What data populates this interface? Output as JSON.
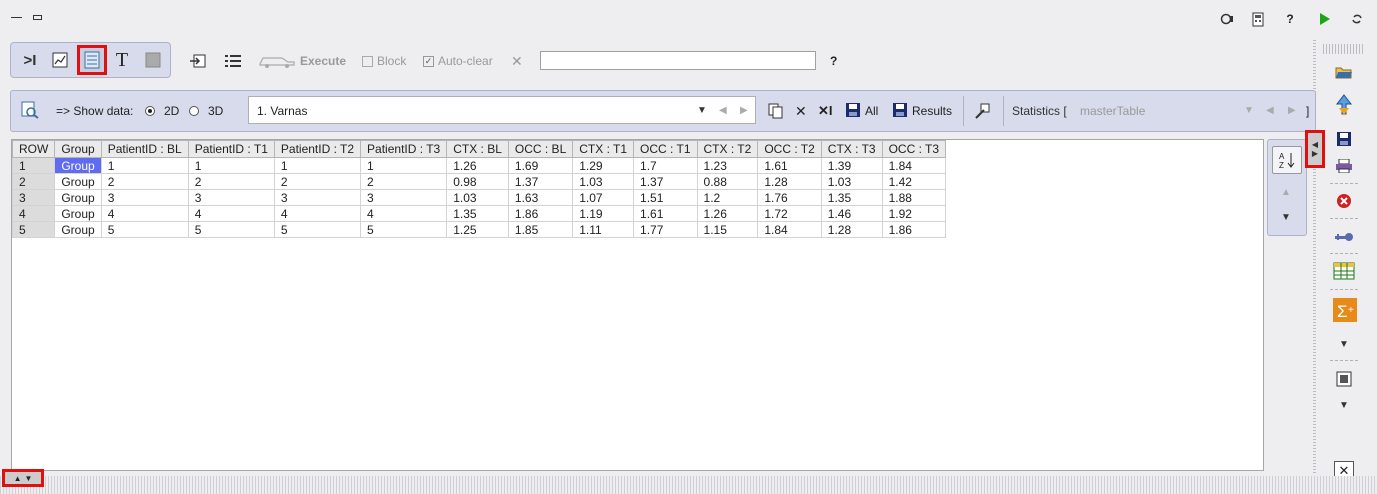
{
  "window": {
    "title_icons": [
      "minimize-icon",
      "maximize-icon"
    ]
  },
  "top_right": {
    "help_label": "?"
  },
  "toolbar": {
    "execute_label": "Execute",
    "block_label": "Block",
    "autoclear_label": "Auto-clear",
    "command_value": "",
    "help_label": "?",
    "text_mode_label": "T",
    "console_label": ">I"
  },
  "show_data": {
    "label": "=> Show data:",
    "option_2d": "2D",
    "option_3d": "3D",
    "selected": "2D",
    "dataset_value": "1. Varnas",
    "all_label": "All",
    "results_label": "Results",
    "statistics_label": "Statistics [",
    "statistics_value": "masterTable",
    "statistics_end": "]"
  },
  "table": {
    "columns": [
      "ROW",
      "Group",
      "PatientID : BL",
      "PatientID : T1",
      "PatientID : T2",
      "PatientID : T3",
      "CTX : BL",
      "OCC : BL",
      "CTX : T1",
      "OCC : T1",
      "CTX : T2",
      "OCC : T2",
      "CTX : T3",
      "OCC : T3"
    ],
    "rows": [
      [
        "1",
        "Group",
        "1",
        "1",
        "1",
        "1",
        "1.26",
        "1.69",
        "1.29",
        "1.7",
        "1.23",
        "1.61",
        "1.39",
        "1.84"
      ],
      [
        "2",
        "Group",
        "2",
        "2",
        "2",
        "2",
        "0.98",
        "1.37",
        "1.03",
        "1.37",
        "0.88",
        "1.28",
        "1.03",
        "1.42"
      ],
      [
        "3",
        "Group",
        "3",
        "3",
        "3",
        "3",
        "1.03",
        "1.63",
        "1.07",
        "1.51",
        "1.2",
        "1.76",
        "1.35",
        "1.88"
      ],
      [
        "4",
        "Group",
        "4",
        "4",
        "4",
        "4",
        "1.35",
        "1.86",
        "1.19",
        "1.61",
        "1.26",
        "1.72",
        "1.46",
        "1.92"
      ],
      [
        "5",
        "Group",
        "5",
        "5",
        "5",
        "5",
        "1.25",
        "1.85",
        "1.11",
        "1.77",
        "1.15",
        "1.84",
        "1.28",
        "1.86"
      ]
    ],
    "selected_cell": "Group"
  },
  "colors": {
    "accent": "#5f6bf0",
    "highlight": "#e01010",
    "panel": "#d8dbeb"
  }
}
